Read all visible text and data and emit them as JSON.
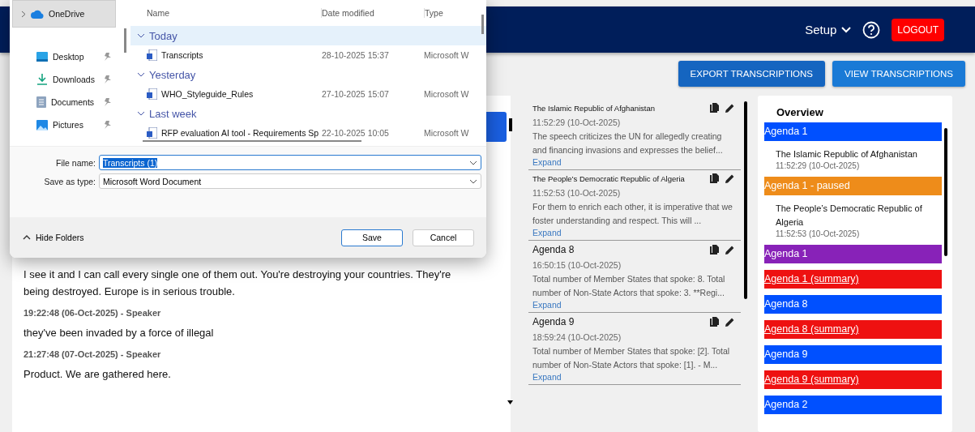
{
  "header": {
    "setup": "Setup",
    "logout": "LOGOUT"
  },
  "toolbar": {
    "buttons": [
      "EXPORT TRANSCRIPTIONS",
      "VIEW TRANSCRIPTIONS"
    ]
  },
  "transcript": {
    "entries": [
      {
        "text": "I see it and I can call every single one of them out. You're destroying your countries. They're being destroyed. Europe is in serious trouble."
      },
      {
        "time": "19:22:48 (06-Oct-2025)",
        "speaker": "- Speaker",
        "text": "they've been invaded by a force of illegal"
      },
      {
        "time": "21:27:48 (07-Oct-2025)",
        "speaker": "- Speaker",
        "text": "Product. We are gathered here."
      }
    ]
  },
  "summaries": [
    {
      "kind": "speaker",
      "title": "The Islamic Republic of Afghanistan",
      "time": "11:52:29 (10-Oct-2025)",
      "text": "The speech criticizes the UN for allegedly creating and financing invasions and expresses the belief...",
      "link": "Expand"
    },
    {
      "kind": "speaker",
      "title": "The People’s Democratic Republic of Algeria",
      "time": "11:52:53 (10-Oct-2025)",
      "text": "For them to enrich each other, it is imperative that we foster understanding and respect. This will ...",
      "link": "Expand"
    },
    {
      "kind": "agenda",
      "title": "Agenda 8",
      "time": "16:50:15 (10-Oct-2025)",
      "text": "Total number of Member States that spoke: 8. Total number of Non-State Actors that spoke: 3. **Regi...",
      "link": "Expand"
    },
    {
      "kind": "agenda",
      "title": "Agenda 9",
      "time": "18:59:24 (10-Oct-2025)",
      "text": "Total number of Member States that spoke: [2]. Total number of Non-State Actors that spoke: [1]. - M...",
      "link": "Expand"
    }
  ],
  "overview": {
    "title": "Overview",
    "items": [
      {
        "kind": "agenda",
        "label": "Agenda 1",
        "color": "#0050ff"
      },
      {
        "kind": "speaker",
        "label": "The Islamic Republic of Afghanistan",
        "time": "11:52:29 (10-Oct-2025)"
      },
      {
        "kind": "agenda",
        "label": "Agenda 1 - paused",
        "color": "#ee8c1a"
      },
      {
        "kind": "speaker",
        "label": "The People’s Democratic Republic of Algeria",
        "time": "11:52:53 (10-Oct-2025)"
      },
      {
        "kind": "agenda",
        "label": "Agenda 1",
        "color": "#8822b8"
      },
      {
        "kind": "summary",
        "label": "Agenda 1 (summary)",
        "color": "#ee1111"
      },
      {
        "kind": "agenda",
        "label": "Agenda 8",
        "color": "#0050ff"
      },
      {
        "kind": "summary",
        "label": "Agenda 8 (summary)",
        "color": "#ee1111"
      },
      {
        "kind": "agenda",
        "label": "Agenda 9",
        "color": "#0050ff"
      },
      {
        "kind": "summary",
        "label": "Agenda 9 (summary)",
        "color": "#ee1111"
      },
      {
        "kind": "agenda",
        "label": "Agenda 2",
        "color": "#0050ff"
      }
    ]
  },
  "dialog": {
    "nav": [
      {
        "label": "OneDrive",
        "selected": true,
        "pinned": false
      },
      {
        "label": "Desktop",
        "selected": false,
        "pinned": true
      },
      {
        "label": "Downloads",
        "selected": false,
        "pinned": true
      },
      {
        "label": "Documents",
        "selected": false,
        "pinned": true
      },
      {
        "label": "Pictures",
        "selected": false,
        "pinned": true
      }
    ],
    "columns": [
      "Name",
      "Date modified",
      "Type"
    ],
    "groups": [
      {
        "name": "Today",
        "selected": true,
        "files": [
          {
            "name": "Transcripts",
            "date": "28-10-2025 15:37",
            "type": "Microsoft W"
          }
        ]
      },
      {
        "name": "Yesterday",
        "selected": false,
        "files": [
          {
            "name": "WHO_Styleguide_Rules",
            "date": "27-10-2025 15:07",
            "type": "Microsoft W"
          }
        ]
      },
      {
        "name": "Last week",
        "selected": false,
        "files": [
          {
            "name": "RFP evaluation AI tool - Requirements Sp",
            "date": "22-10-2025 10:05",
            "type": "Microsoft W"
          }
        ]
      }
    ],
    "file_name_label": "File name:",
    "file_name": "Transcripts (1)",
    "type_label": "Save as type:",
    "type": "Microsoft Word Document",
    "hide_folders": "Hide Folders",
    "save": "Save",
    "cancel": "Cancel"
  }
}
